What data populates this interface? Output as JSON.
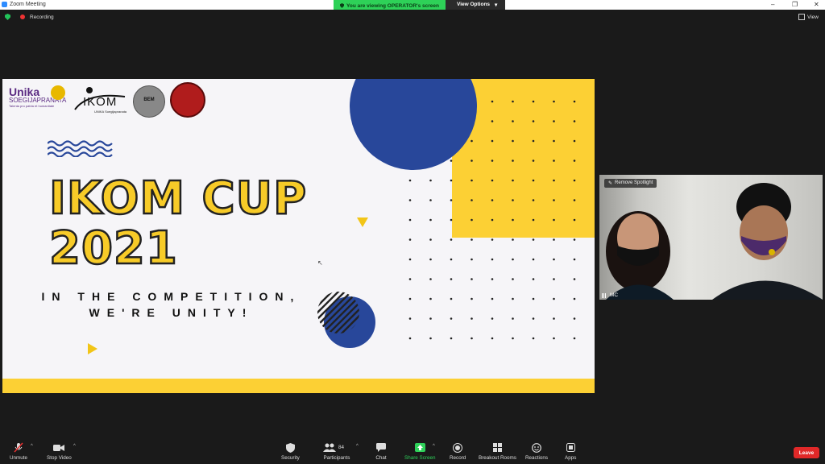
{
  "window": {
    "title": "Zoom Meeting",
    "banner_viewing": "You are viewing OPERATOR's screen",
    "view_options_label": "View Options",
    "controls": {
      "minimize": "–",
      "maximize": "❐",
      "close": "✕"
    }
  },
  "status": {
    "recording_label": "Recording",
    "view_label": "View"
  },
  "slide": {
    "logos": {
      "unika_word": "Unika",
      "unika_name": "SOEGIJAPRANATA",
      "unika_motto": "Talenta pro patria et humanitate",
      "ikom_text": "IKOM",
      "ikom_sub": "UNIKA Soegijapranata",
      "bem_text": "BEM"
    },
    "title_line1": "IKOM CUP",
    "title_line2": "2021",
    "tagline_line1": "IN THE COMPETITION,",
    "tagline_line2": "WE'RE UNITY!",
    "colors": {
      "yellow": "#fcd034",
      "blue": "#28479a",
      "background": "#f6f5f8"
    }
  },
  "video": {
    "remove_spotlight_label": "Remove Spotlight",
    "participant_name": "MC"
  },
  "toolbar": {
    "unmute": {
      "label": "Unmute",
      "icon": "microphone-muted-icon"
    },
    "stop_video": {
      "label": "Stop Video",
      "icon": "video-camera-icon"
    },
    "security": {
      "label": "Security",
      "icon": "shield-icon"
    },
    "participants": {
      "label": "Participants",
      "count": "84",
      "icon": "participants-icon"
    },
    "chat": {
      "label": "Chat",
      "icon": "chat-icon"
    },
    "share_screen": {
      "label": "Share Screen",
      "icon": "share-screen-icon",
      "color": "#2fd15a"
    },
    "record": {
      "label": "Record",
      "icon": "record-icon"
    },
    "breakout_rooms": {
      "label": "Breakout Rooms",
      "icon": "grid-icon"
    },
    "reactions": {
      "label": "Reactions",
      "icon": "smile-icon"
    },
    "apps": {
      "label": "Apps",
      "icon": "apps-icon"
    },
    "leave": {
      "label": "Leave",
      "color": "#e02828"
    }
  }
}
